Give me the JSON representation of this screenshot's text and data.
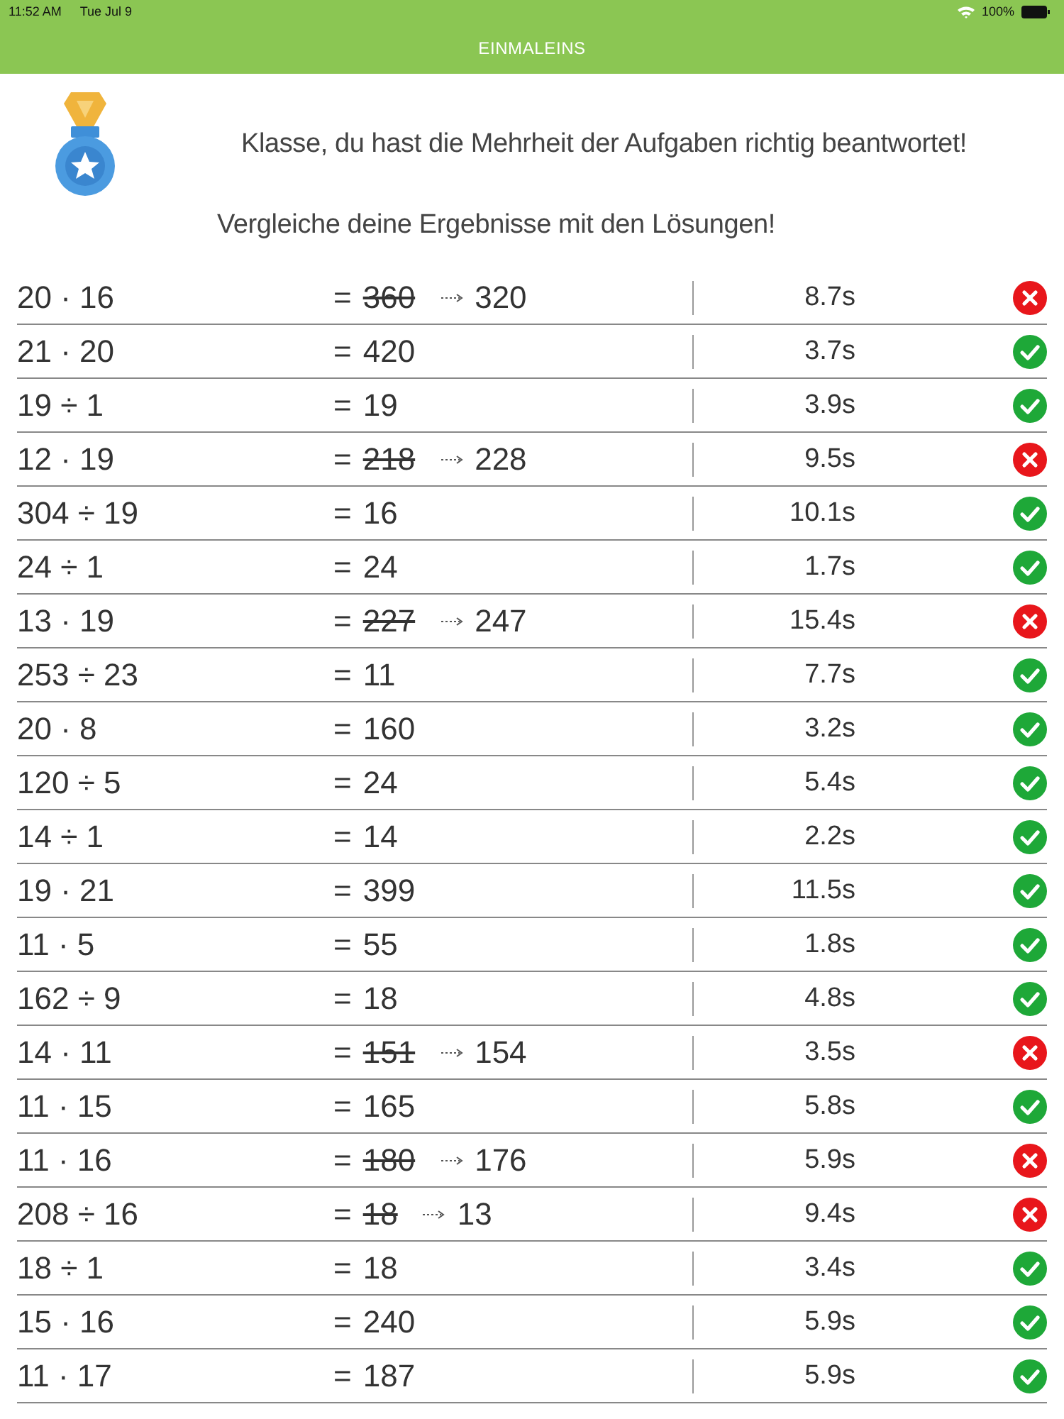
{
  "status_bar": {
    "time": "11:52 AM",
    "date": "Tue Jul 9",
    "battery": "100%"
  },
  "nav_bar": {
    "title": "EINMALEINS"
  },
  "result": {
    "message": "Klasse, du hast die Mehrheit der Aufgaben richtig beantwortet!",
    "instruction": "Vergleiche deine Ergebnisse mit den Lösungen!"
  },
  "rows": [
    {
      "task": "20 · 16",
      "equals": "=",
      "answer": "360",
      "correct": false,
      "correction": "320",
      "time": "8.7s"
    },
    {
      "task": "21 · 20",
      "equals": "=",
      "answer": "420",
      "correct": true,
      "time": "3.7s"
    },
    {
      "task": "19 ÷ 1",
      "equals": "=",
      "answer": "19",
      "correct": true,
      "time": "3.9s"
    },
    {
      "task": "12 · 19",
      "equals": "=",
      "answer": "218",
      "correct": false,
      "correction": "228",
      "time": "9.5s"
    },
    {
      "task": "304 ÷ 19",
      "equals": "=",
      "answer": "16",
      "correct": true,
      "time": "10.1s"
    },
    {
      "task": "24 ÷ 1",
      "equals": "=",
      "answer": "24",
      "correct": true,
      "time": "1.7s"
    },
    {
      "task": "13 · 19",
      "equals": "=",
      "answer": "227",
      "correct": false,
      "correction": "247",
      "time": "15.4s"
    },
    {
      "task": "253 ÷ 23",
      "equals": "=",
      "answer": "11",
      "correct": true,
      "time": "7.7s"
    },
    {
      "task": "20 · 8",
      "equals": "=",
      "answer": "160",
      "correct": true,
      "time": "3.2s"
    },
    {
      "task": "120 ÷ 5",
      "equals": "=",
      "answer": "24",
      "correct": true,
      "time": "5.4s"
    },
    {
      "task": "14 ÷ 1",
      "equals": "=",
      "answer": "14",
      "correct": true,
      "time": "2.2s"
    },
    {
      "task": "19 · 21",
      "equals": "=",
      "answer": "399",
      "correct": true,
      "time": "11.5s"
    },
    {
      "task": "11 · 5",
      "equals": "=",
      "answer": "55",
      "correct": true,
      "time": "1.8s"
    },
    {
      "task": "162 ÷ 9",
      "equals": "=",
      "answer": "18",
      "correct": true,
      "time": "4.8s"
    },
    {
      "task": "14 · 11",
      "equals": "=",
      "answer": "151",
      "correct": false,
      "correction": "154",
      "time": "3.5s"
    },
    {
      "task": "11 · 15",
      "equals": "=",
      "answer": "165",
      "correct": true,
      "time": "5.8s"
    },
    {
      "task": "11 · 16",
      "equals": "=",
      "answer": "180",
      "correct": false,
      "correction": "176",
      "time": "5.9s"
    },
    {
      "task": "208 ÷ 16",
      "equals": "=",
      "answer": "18",
      "correct": false,
      "correction": "13",
      "time": "9.4s"
    },
    {
      "task": "18 ÷ 1",
      "equals": "=",
      "answer": "18",
      "correct": true,
      "time": "3.4s"
    },
    {
      "task": "15 · 16",
      "equals": "=",
      "answer": "240",
      "correct": true,
      "time": "5.9s"
    },
    {
      "task": "11 · 17",
      "equals": "=",
      "answer": "187",
      "correct": true,
      "time": "5.9s"
    }
  ]
}
